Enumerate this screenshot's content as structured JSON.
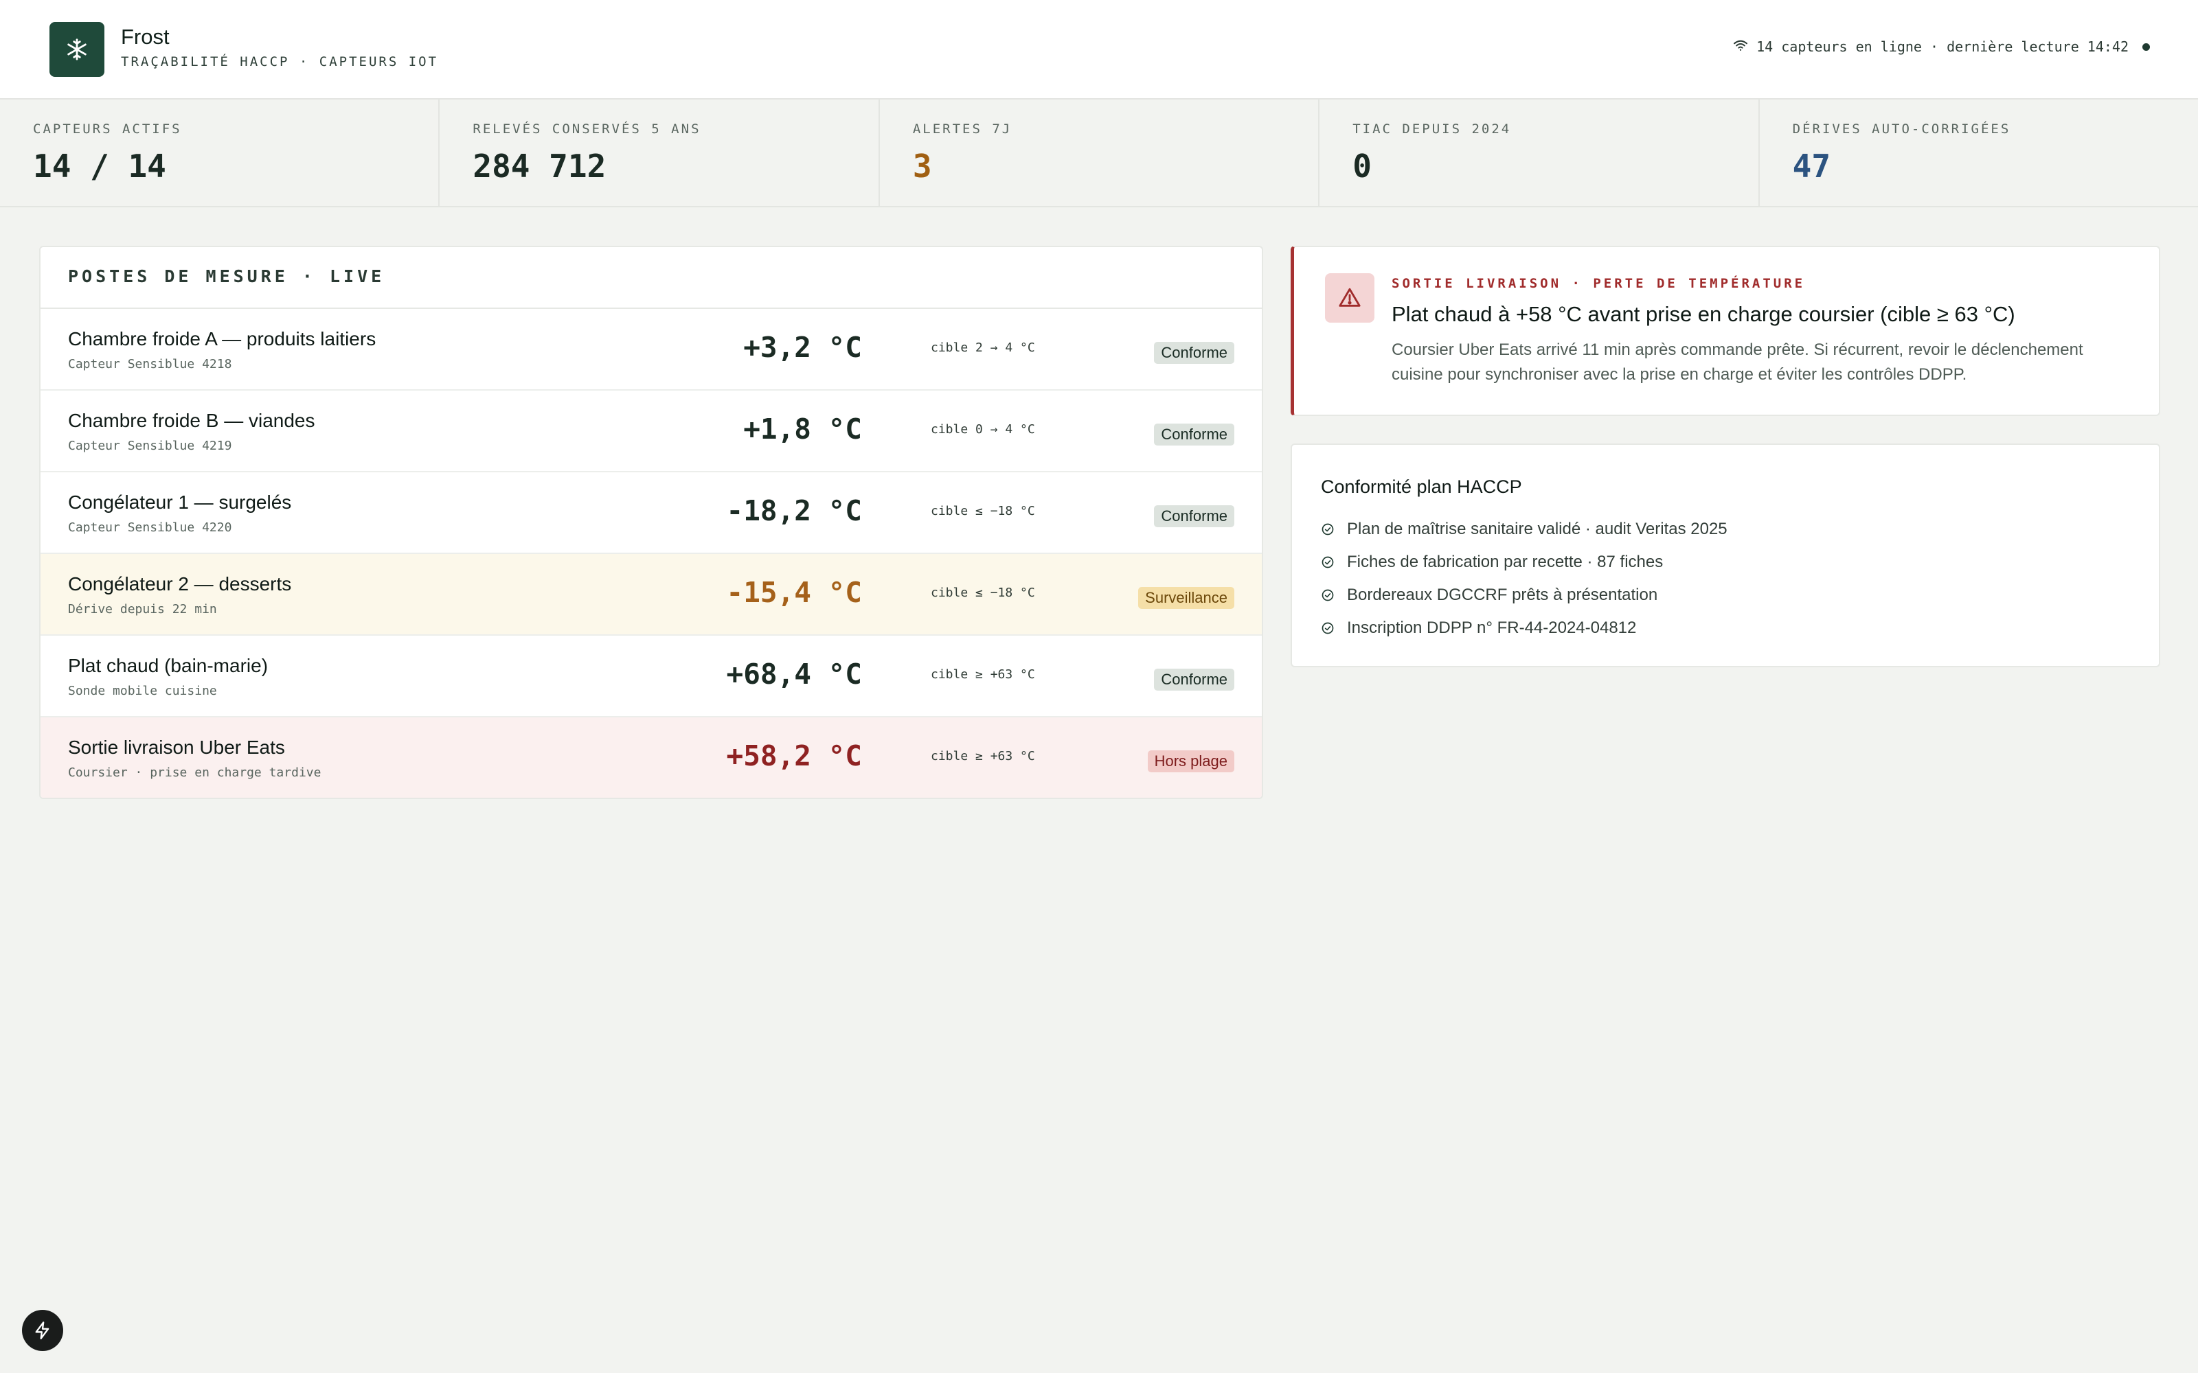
{
  "header": {
    "title": "Frost",
    "subtitle": "TRAÇABILITÉ HACCP · CAPTEURS IOT",
    "status": "14 capteurs en ligne · dernière lecture 14:42"
  },
  "stats": [
    {
      "label": "CAPTEURS ACTIFS",
      "value": "14 / 14"
    },
    {
      "label": "RELEVÉS CONSERVÉS 5 ANS",
      "value": "284 712"
    },
    {
      "label": "ALERTES 7J",
      "value": "3"
    },
    {
      "label": "TIAC DEPUIS 2024",
      "value": "0"
    },
    {
      "label": "DÉRIVES AUTO-CORRIGÉES",
      "value": "47"
    }
  ],
  "panel": {
    "title": "POSTES DE MESURE · LIVE",
    "rows": [
      {
        "name": "Chambre froide A — produits laitiers",
        "sub": "Capteur Sensiblue 4218",
        "temp": "+3,2 °C",
        "target": "cible 2 → 4 °C",
        "badge": "Conforme"
      },
      {
        "name": "Chambre froide B — viandes",
        "sub": "Capteur Sensiblue 4219",
        "temp": "+1,8 °C",
        "target": "cible 0 → 4 °C",
        "badge": "Conforme"
      },
      {
        "name": "Congélateur 1 — surgelés",
        "sub": "Capteur Sensiblue 4220",
        "temp": "-18,2 °C",
        "target": "cible ≤ −18 °C",
        "badge": "Conforme"
      },
      {
        "name": "Congélateur 2 — desserts",
        "sub": "Dérive depuis 22 min",
        "temp": "-15,4 °C",
        "target": "cible ≤ −18 °C",
        "badge": "Surveillance"
      },
      {
        "name": "Plat chaud (bain-marie)",
        "sub": "Sonde mobile cuisine",
        "temp": "+68,4 °C",
        "target": "cible ≥ +63 °C",
        "badge": "Conforme"
      },
      {
        "name": "Sortie livraison Uber Eats",
        "sub": "Coursier · prise en charge tardive",
        "temp": "+58,2 °C",
        "target": "cible ≥ +63 °C",
        "badge": "Hors plage"
      }
    ]
  },
  "alert": {
    "kicker": "SORTIE LIVRAISON · PERTE DE TEMPÉRATURE",
    "title": "Plat chaud à +58 °C avant prise en charge coursier (cible ≥ 63 °C)",
    "text": "Coursier Uber Eats arrivé 11 min après commande prête. Si récurrent, revoir le déclenchement cuisine pour synchroniser avec la prise en charge et éviter les contrôles DDPP."
  },
  "compliance": {
    "title": "Conformité plan HACCP",
    "items": [
      "Plan de maîtrise sanitaire validé · audit Veritas 2025",
      "Fiches de fabrication par recette · 87 fiches",
      "Bordereaux DGCCRF prêts à présentation",
      "Inscription DDPP n° FR-44-2024-04812"
    ]
  },
  "colors": {
    "brand": "#1f4a3a",
    "warn": "#a5611a",
    "danger": "#8f2222",
    "info": "#2c5380"
  }
}
